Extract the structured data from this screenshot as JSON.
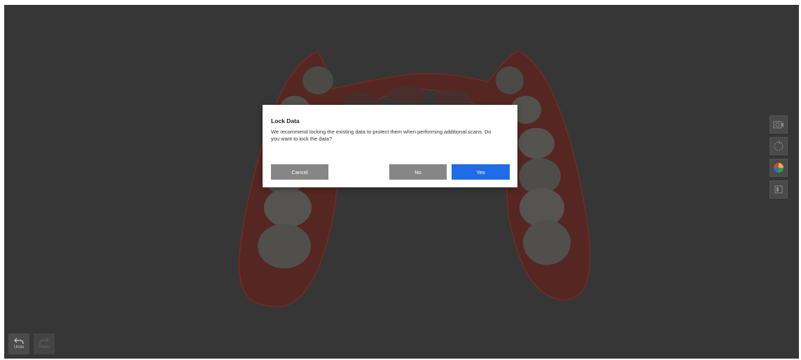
{
  "dialog": {
    "title": "Lock Data",
    "message": "We recommend locking the existing data to protect them when performing additional scans. Do you want to lock the data?",
    "cancel_label": "Cancel",
    "no_label": "No",
    "yes_label": "Yes"
  },
  "history": {
    "undo_label": "Undo",
    "redo_label": "Redo"
  },
  "toolbar": {
    "items": [
      {
        "icon": "camera-icon"
      },
      {
        "icon": "rotate-icon"
      },
      {
        "icon": "color-wheel-icon"
      },
      {
        "icon": "texture-icon"
      }
    ]
  },
  "colors": {
    "background": "#3e3e3e",
    "gum": "#7a2a22",
    "tooth": "#6e6c66",
    "primary": "#1f6ce8",
    "secondary_button": "#868686"
  }
}
